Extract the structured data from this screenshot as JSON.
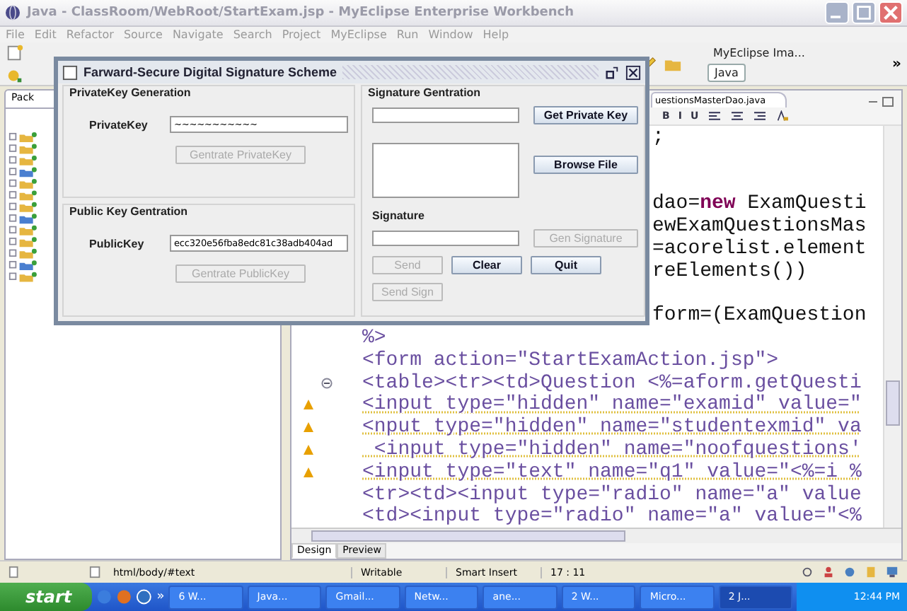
{
  "window": {
    "title": "Java - ClassRoom/WebRoot/StartExam.jsp - MyEclipse Enterprise Workbench"
  },
  "menu": [
    "File",
    "Edit",
    "Refactor",
    "Source",
    "Navigate",
    "Search",
    "Project",
    "MyEclipse",
    "Run",
    "Window",
    "Help"
  ],
  "perspectives": [
    {
      "label": "MyEclipse Ima...",
      "selected": false
    },
    {
      "label": "Java",
      "selected": true
    }
  ],
  "toolbar_more": "»",
  "package_explorer": {
    "tab": "Pack"
  },
  "editor": {
    "tab": "uestionsMasterDao.java",
    "format_buttons": [
      "B",
      "I",
      "U"
    ],
    "lines": [
      {
        "kind": "java",
        "covered": true,
        "warning": false,
        "collapsible": false,
        "text": ";"
      },
      {
        "kind": "blank"
      },
      {
        "kind": "blank"
      },
      {
        "kind": "java",
        "covered": true,
        "warning": false,
        "collapsible": false,
        "text": "dao=**new** ExamQuesti"
      },
      {
        "kind": "java",
        "covered": true,
        "warning": false,
        "collapsible": false,
        "text": "ewExamQuestionsMas"
      },
      {
        "kind": "java",
        "covered": true,
        "warning": false,
        "collapsible": false,
        "text": "=acorelist.element"
      },
      {
        "kind": "java",
        "covered": true,
        "warning": false,
        "collapsible": false,
        "text": "reElements())"
      },
      {
        "kind": "blank"
      },
      {
        "kind": "java",
        "covered": true,
        "warning": false,
        "collapsible": false,
        "text": "form=(ExamQuestion"
      },
      {
        "kind": "markup",
        "covered": false,
        "warning": false,
        "collapsible": false,
        "text": "%>"
      },
      {
        "kind": "markup",
        "covered": false,
        "warning": false,
        "collapsible": false,
        "text": "<form action=\"StartExamAction.jsp\">"
      },
      {
        "kind": "markup",
        "covered": false,
        "warning": false,
        "collapsible": true,
        "text": "<table><tr><td>Question <%=aform.getQuesti"
      },
      {
        "kind": "markup",
        "covered": false,
        "warning": true,
        "collapsible": false,
        "text": "<input type=\"hidden\" name=\"examid\" value=\""
      },
      {
        "kind": "markup",
        "covered": false,
        "warning": true,
        "collapsible": false,
        "text": "<nput type=\"hidden\" name=\"studentexmid\" va"
      },
      {
        "kind": "markup",
        "covered": false,
        "warning": true,
        "collapsible": false,
        "text": " <input type=\"hidden\" name=\"noofquestions'"
      },
      {
        "kind": "markup",
        "covered": false,
        "warning": true,
        "collapsible": false,
        "text": "<input type=\"text\" name=\"q1\" value=\"<%=i %"
      },
      {
        "kind": "markup",
        "covered": false,
        "warning": false,
        "collapsible": false,
        "text": "<tr><td><input type=\"radio\" name=\"a\" value"
      },
      {
        "kind": "markup",
        "covered": false,
        "warning": false,
        "collapsible": false,
        "text": "<td><input type=\"radio\" name=\"a\" value=\"<%"
      }
    ],
    "view_tabs": [
      {
        "label": "Design",
        "selected": true
      },
      {
        "label": "Preview",
        "selected": false
      }
    ]
  },
  "status_bar": {
    "path": "html/body/#text",
    "mode": "Writable",
    "insert": "Smart Insert",
    "position": "17 : 11"
  },
  "taskbar": {
    "start": "start",
    "more": "»",
    "tasks": [
      {
        "label": "6 W...",
        "selected": false
      },
      {
        "label": "Java...",
        "selected": false
      },
      {
        "label": "Gmail...",
        "selected": false
      },
      {
        "label": "Netw...",
        "selected": false
      },
      {
        "label": "ane...",
        "selected": false
      },
      {
        "label": "2 W...",
        "selected": false
      },
      {
        "label": "Micro...",
        "selected": false
      },
      {
        "label": "2 J...",
        "selected": true
      }
    ],
    "clock": "12:44 PM"
  },
  "dialog": {
    "title": "Farward-Secure Digital Signature Scheme",
    "private_key": {
      "legend": "PrivateKey Generation",
      "label": "PrivateKey",
      "value": "~~~~~~~~~~~",
      "button": {
        "label": "Gentrate PrivateKey",
        "disabled": true
      }
    },
    "public_key": {
      "legend": "Public Key Gentration",
      "label": "PublicKey",
      "value": "ecc320e56fba8edc81c38adb404ad",
      "button": {
        "label": "Gentrate PublicKey",
        "disabled": true
      }
    },
    "signature_generation": {
      "legend": "Signature Gentration",
      "get_key_button": {
        "label": "Get Private Key",
        "disabled": false
      },
      "browse_button": {
        "label": "Browse File",
        "disabled": false
      },
      "signature_label": "Signature",
      "gen_button": {
        "label": "Gen Signature",
        "disabled": true
      },
      "actions": [
        {
          "label": "Send",
          "disabled": true
        },
        {
          "label": "Clear",
          "disabled": false
        },
        {
          "label": "Quit",
          "disabled": false
        }
      ],
      "send_sign_button": {
        "label": "Send Sign",
        "disabled": true
      }
    }
  }
}
